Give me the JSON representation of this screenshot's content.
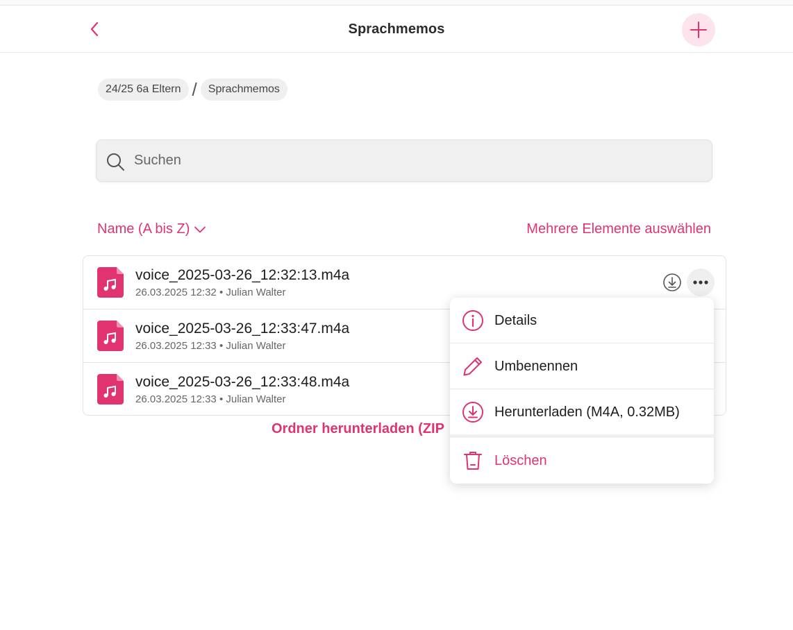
{
  "header": {
    "title": "Sprachmemos",
    "back_icon": "chevron-left-icon",
    "add_icon": "plus-icon"
  },
  "breadcrumb": [
    {
      "label": "24/25 6a Eltern"
    },
    {
      "label": "Sprachmemos"
    }
  ],
  "breadcrumb_separator": "/",
  "search": {
    "placeholder": "Suchen",
    "value": ""
  },
  "sort": {
    "label": "Name (A bis Z)"
  },
  "multi_select_label": "Mehrere Elemente auswählen",
  "files": [
    {
      "name": "voice_2025-03-26_12:32:13.m4a",
      "meta": "26.03.2025 12:32 • Julian Walter"
    },
    {
      "name": "voice_2025-03-26_12:33:47.m4a",
      "meta": "26.03.2025 12:33 • Julian Walter"
    },
    {
      "name": "voice_2025-03-26_12:33:48.m4a",
      "meta": "26.03.2025 12:33 • Julian Walter"
    }
  ],
  "download_zip_label": "Ordner herunterladen (ZIP",
  "context_menu": {
    "items": [
      {
        "label": "Details",
        "icon": "info-icon"
      },
      {
        "label": "Umbenennen",
        "icon": "pencil-icon"
      },
      {
        "label": "Herunterladen (M4A, 0.32MB)",
        "icon": "download-icon"
      },
      {
        "label": "Löschen",
        "icon": "trash-icon"
      }
    ]
  },
  "colors": {
    "accent": "#e0336f",
    "accent_light": "#fde4ec"
  }
}
